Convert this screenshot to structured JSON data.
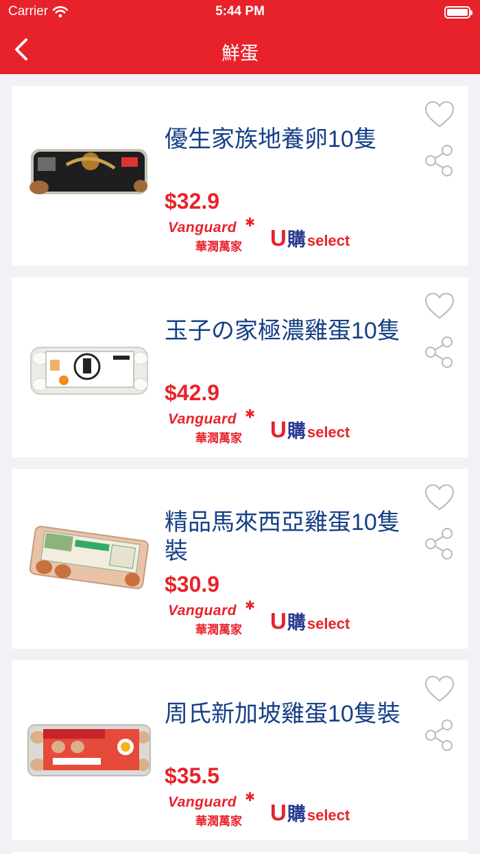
{
  "status_bar": {
    "carrier": "Carrier",
    "time": "5:44 PM"
  },
  "nav": {
    "title": "鮮蛋"
  },
  "products": [
    {
      "name": "優生家族地養卵10隻",
      "price": "$32.9",
      "retailer_en": "Vanguard",
      "retailer_cn": "華潤萬家",
      "brand_u": "U",
      "brand_cn": "購",
      "brand_select": "select"
    },
    {
      "name": "玉子の家極濃雞蛋10隻",
      "price": "$42.9",
      "retailer_en": "Vanguard",
      "retailer_cn": "華潤萬家",
      "brand_u": "U",
      "brand_cn": "購",
      "brand_select": "select"
    },
    {
      "name": "精品馬來西亞雞蛋10隻裝",
      "price": "$30.9",
      "retailer_en": "Vanguard",
      "retailer_cn": "華潤萬家",
      "brand_u": "U",
      "brand_cn": "購",
      "brand_select": "select"
    },
    {
      "name": "周氏新加坡雞蛋10隻裝",
      "price": "$35.5",
      "retailer_en": "Vanguard",
      "retailer_cn": "華潤萬家",
      "brand_u": "U",
      "brand_cn": "購",
      "brand_select": "select"
    }
  ],
  "colors": {
    "brand_red": "#e8222a",
    "title_blue": "#163f86",
    "background": "#f2f2f6"
  },
  "icons": {
    "back": "chevron-left-icon",
    "favorite": "heart-outline-icon",
    "share": "share-icon"
  }
}
